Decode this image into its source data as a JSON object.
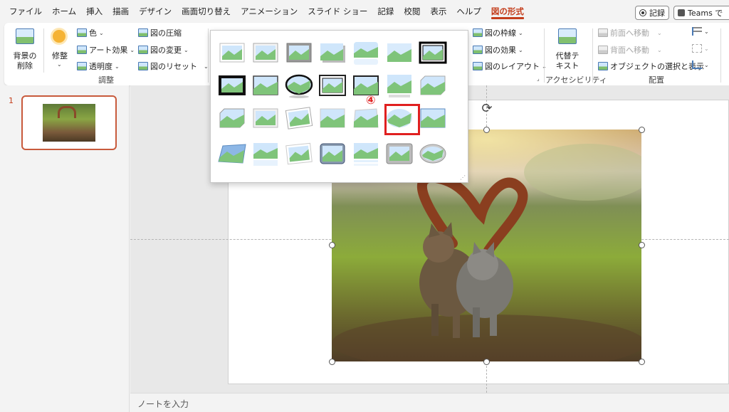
{
  "menu": {
    "tabs": [
      "ファイル",
      "ホーム",
      "挿入",
      "描画",
      "デザイン",
      "画面切り替え",
      "アニメーション",
      "スライド ショー",
      "記録",
      "校閲",
      "表示",
      "ヘルプ",
      "図の形式"
    ],
    "active_tab": "図の形式",
    "record_label": "記録",
    "teams_label": "Teams で"
  },
  "ribbon": {
    "remove_bg": [
      "背景の",
      "削除"
    ],
    "corrections": "修整",
    "color": "色",
    "artistic": "アート効果",
    "transparency": "透明度",
    "compress": "図の圧縮",
    "change": "図の変更",
    "reset": "図のリセット",
    "adjust_group": "調整",
    "border": "図の枠線",
    "effects": "図の効果",
    "layout": "図のレイアウト",
    "alt_text": [
      "代替テ",
      "キスト"
    ],
    "accessibility_group": "アクセシビリティ",
    "bring_forward": "前面へ移動",
    "send_backward": "背面へ移動",
    "selection_pane": "オブジェクトの選択と表示",
    "arrange_group": "配置"
  },
  "slides_panel": {
    "slide_number": "1"
  },
  "annotation": {
    "step": "④",
    "color": "#e02020"
  },
  "notes": {
    "placeholder": "ノートを入力"
  },
  "colors": {
    "accent": "#c43e1c",
    "highlight": "#e02020"
  }
}
